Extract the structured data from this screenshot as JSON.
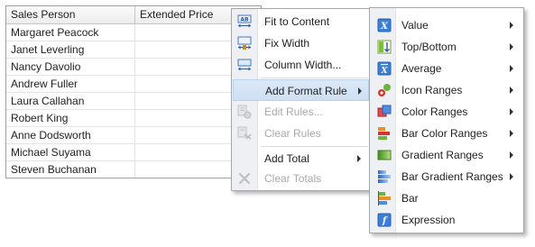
{
  "grid": {
    "columns": [
      "Sales Person",
      "Extended Price"
    ],
    "rows": [
      [
        "Margaret Peacock",
        ""
      ],
      [
        "Janet Leverling",
        ""
      ],
      [
        "Nancy Davolio",
        ""
      ],
      [
        "Andrew Fuller",
        ""
      ],
      [
        "Laura Callahan",
        ""
      ],
      [
        "Robert King",
        ""
      ],
      [
        "Anne Dodsworth",
        ""
      ],
      [
        "Michael Suyama",
        ""
      ],
      [
        "Steven Buchanan",
        ""
      ]
    ]
  },
  "context_menu": {
    "items": [
      {
        "label": "Fit to Content",
        "icon": "fit-to-content-icon",
        "enabled": true,
        "submenu": false
      },
      {
        "label": "Fix Width",
        "icon": "fix-width-icon",
        "enabled": true,
        "submenu": false
      },
      {
        "label": "Column Width...",
        "icon": "column-width-icon",
        "enabled": true,
        "submenu": false
      },
      {
        "label": "Add Format Rule",
        "icon": "",
        "enabled": true,
        "submenu": true,
        "highlighted": true
      },
      {
        "label": "Edit Rules...",
        "icon": "edit-rules-icon",
        "enabled": false,
        "submenu": false
      },
      {
        "label": "Clear Rules",
        "icon": "clear-rules-icon",
        "enabled": false,
        "submenu": false
      },
      {
        "label": "Add Total",
        "icon": "",
        "enabled": true,
        "submenu": true
      },
      {
        "label": "Clear Totals",
        "icon": "clear-totals-icon",
        "enabled": false,
        "submenu": false
      }
    ]
  },
  "format_rule_menu": {
    "items": [
      {
        "label": "Value",
        "icon": "value-rule-icon",
        "submenu": true
      },
      {
        "label": "Top/Bottom",
        "icon": "top-bottom-icon",
        "submenu": true
      },
      {
        "label": "Average",
        "icon": "average-icon",
        "submenu": true
      },
      {
        "label": "Icon Ranges",
        "icon": "icon-ranges-icon",
        "submenu": true
      },
      {
        "label": "Color Ranges",
        "icon": "color-ranges-icon",
        "submenu": true
      },
      {
        "label": "Bar Color Ranges",
        "icon": "bar-color-ranges-icon",
        "submenu": true
      },
      {
        "label": "Gradient Ranges",
        "icon": "gradient-ranges-icon",
        "submenu": true
      },
      {
        "label": "Bar Gradient Ranges",
        "icon": "bar-gradient-ranges-icon",
        "submenu": true
      },
      {
        "label": "Bar",
        "icon": "bar-icon",
        "submenu": false
      },
      {
        "label": "Expression",
        "icon": "expression-icon",
        "submenu": false
      }
    ]
  }
}
